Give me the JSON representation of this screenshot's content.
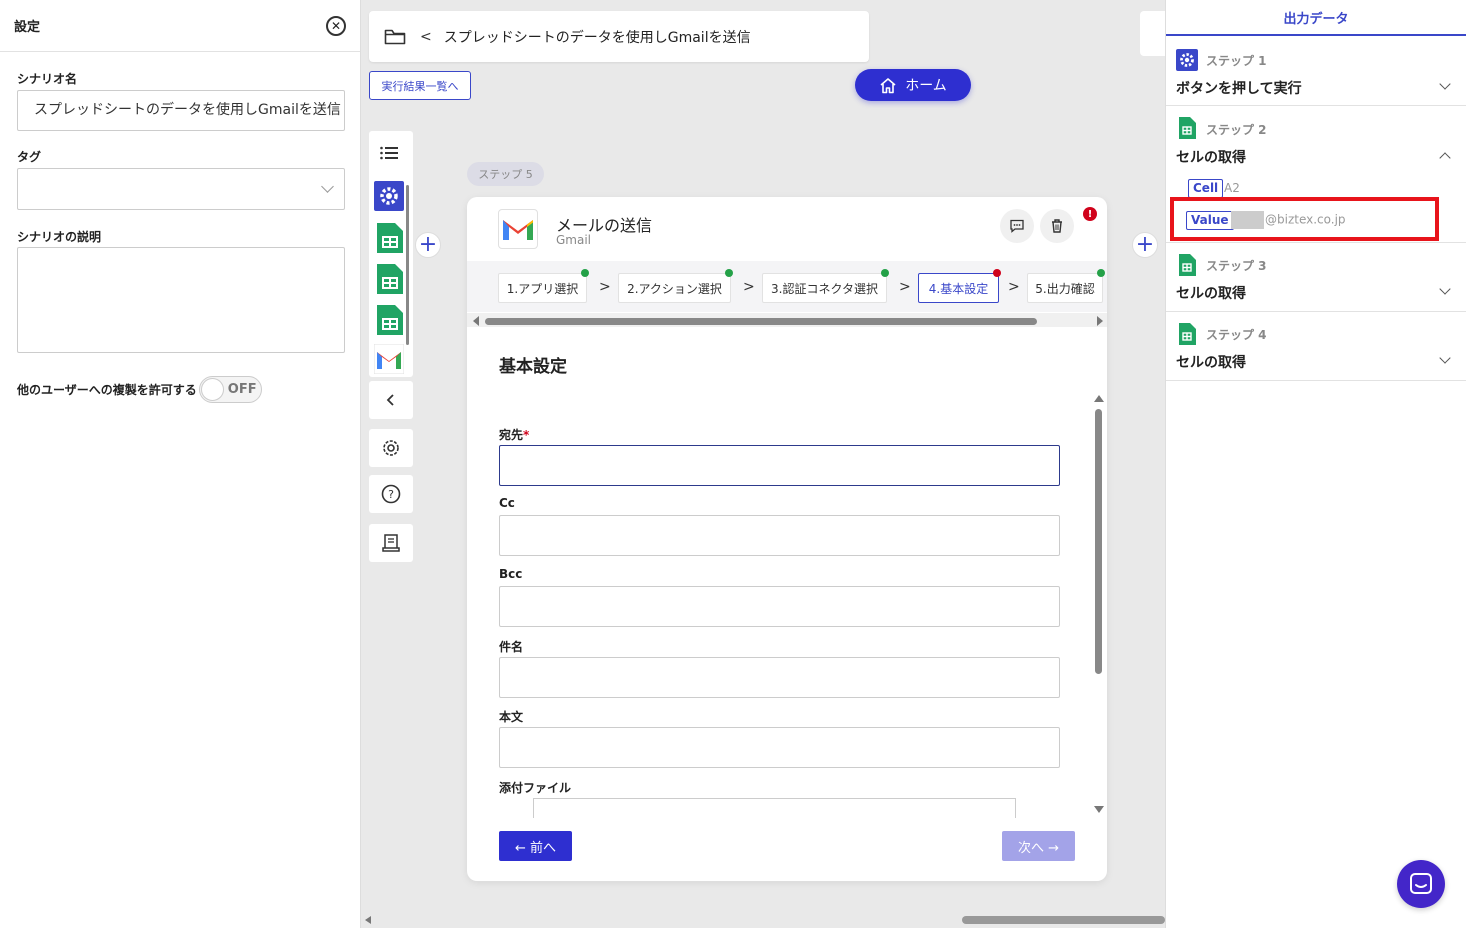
{
  "settings": {
    "title": "設定",
    "scenario_name_label": "シナリオ名",
    "scenario_name_value": "スプレッドシートのデータを使用しGmailを送信",
    "tag_label": "タグ",
    "desc_label": "シナリオの説明",
    "copy_label": "他のユーザーへの複製を許可する",
    "copy_toggle": "OFF"
  },
  "header": {
    "title": "スプレッドシートのデータを使用しGmailを送信",
    "results_label": "実行結果一覧へ",
    "home_label": "ホーム"
  },
  "step_pill": "ステップ 5",
  "card": {
    "app_title": "メールの送信",
    "app_sub": "Gmail",
    "tabs": [
      {
        "label": "1.アプリ選択"
      },
      {
        "label": "2.アクション選択"
      },
      {
        "label": "3.認証コネクタ選択"
      },
      {
        "label": "4.基本設定"
      },
      {
        "label": "5.出力確認"
      }
    ],
    "form_title": "基本設定",
    "fields": {
      "to": "宛先",
      "cc": "Cc",
      "bcc": "Bcc",
      "subject": "件名",
      "body": "本文",
      "attach": "添付ファイル"
    },
    "prev_label": "← 前へ",
    "next_label": "次へ →"
  },
  "output": {
    "title": "出力データ",
    "steps": [
      {
        "num": "ステップ 1",
        "name": "ボタンを押して実行"
      },
      {
        "num": "ステップ 2",
        "name": "セルの取得"
      },
      {
        "num": "ステップ 3",
        "name": "セルの取得"
      },
      {
        "num": "ステップ 4",
        "name": "セルの取得"
      }
    ],
    "cell_key": "Cell",
    "cell_val": "A2",
    "value_key": "Value",
    "value_val": "@biztex.co.jp"
  },
  "colors": {
    "primary": "#2e2fd0",
    "accent": "#3a47c9",
    "error": "#d0021b",
    "success": "#24a148",
    "highlight": "#e8141b"
  }
}
